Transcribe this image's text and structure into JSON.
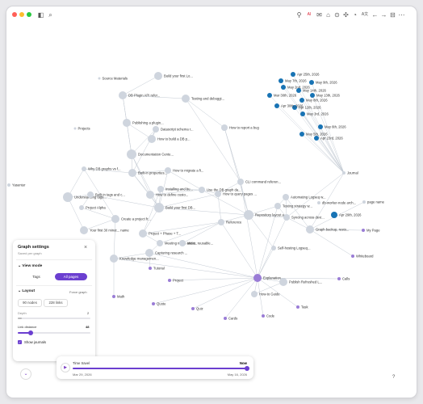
{
  "window": {
    "traffic_lights": [
      "#ff5f57",
      "#febc2e",
      "#28c840"
    ],
    "left_icons": [
      "sidebar-icon",
      "search-icon"
    ],
    "right_icons": [
      {
        "name": "person-icon",
        "glyph": "⚲"
      },
      {
        "name": "ai-badge-icon",
        "glyph": "AI"
      },
      {
        "name": "mail-icon",
        "glyph": "✉"
      },
      {
        "name": "home-icon",
        "glyph": "⌂"
      },
      {
        "name": "lock-icon",
        "glyph": "⊙"
      },
      {
        "name": "puzzle-icon",
        "glyph": "✣"
      },
      {
        "name": "alarm-icon",
        "glyph": "◔"
      },
      {
        "name": "translate-icon",
        "glyph": "A文"
      },
      {
        "name": "back-arrow-icon",
        "glyph": "←"
      },
      {
        "name": "forward-arrow-icon",
        "glyph": "→"
      },
      {
        "name": "split-icon",
        "glyph": "⊟"
      },
      {
        "name": "more-icon",
        "glyph": "⋯"
      }
    ]
  },
  "graph": {
    "nodes": [
      {
        "label": "Source Materials"
      },
      {
        "label": "Build your first Lo..."
      },
      {
        "label": "DB Plugin API refer..."
      },
      {
        "label": "Testing and debuggi..."
      },
      {
        "label": "Projects"
      },
      {
        "label": "Publishing a plugin..."
      },
      {
        "label": "Datascript schema r..."
      },
      {
        "label": "How to build a DB p..."
      },
      {
        "label": "How to report a bug"
      },
      {
        "label": "Documentation Cente..."
      },
      {
        "label": "Why DB graphs vs f..."
      },
      {
        "label": "Built-in properties..."
      },
      {
        "label": "How to migrate a fi..."
      },
      {
        "label": "Installing and bu..."
      },
      {
        "label": "Use the DB graph da..."
      },
      {
        "label": "CLI command referen..."
      },
      {
        "label": "Understanding tags..."
      },
      {
        "label": "Built-in tags and c..."
      },
      {
        "label": "How to define custo..."
      },
      {
        "label": "How to query pages ..."
      },
      {
        "label": "Automating Logseq w..."
      },
      {
        "label": "Build your first DB..."
      },
      {
        "label": "Project Alpha"
      },
      {
        "label": "Create a project fr..."
      },
      {
        "label": "Testing strategy w..."
      },
      {
        "label": "Repository layout a..."
      },
      {
        "label": "Syncing across devi..."
      },
      {
        "label": "Your first 30 minut... name"
      },
      {
        "label": "Project + Phase + T..."
      },
      {
        "label": "Meeting notes and t..."
      },
      {
        "label": "Ideas: reusable..."
      },
      {
        "label": "Capturing research ..."
      },
      {
        "label": "Knowledge managemen..."
      },
      {
        "label": "Reference"
      },
      {
        "label": "Graph backup, resto..."
      },
      {
        "label": "Self-hosting Logseq..."
      },
      {
        "label": "Explanation"
      },
      {
        "label": "How-to Guide"
      },
      {
        "label": "Publish Refreshed L..."
      },
      {
        "label": "Tutorial"
      },
      {
        "label": "Project"
      },
      {
        "label": "Math"
      },
      {
        "label": "Quote"
      },
      {
        "label": "Quiz"
      },
      {
        "label": "Cards"
      },
      {
        "label": "Code"
      },
      {
        "label": "Task"
      },
      {
        "label": "Calls"
      },
      {
        "label": "Whiteboard"
      },
      {
        "label": "My Page"
      },
      {
        "label": "page name"
      },
      {
        "label": "db-worker-node arch..."
      },
      {
        "label": "Journal"
      },
      {
        "label": "Apr 29th, 2026"
      },
      {
        "label": "Yasenter"
      }
    ],
    "journals": [
      "Apr 25th, 2026",
      "May 7th, 2026",
      "May 9th, 2026",
      "May 2nd, 2026",
      "May 14th, 2026",
      "Mar 30th, 2026",
      "May 8th, 2026",
      "May 13th, 2026",
      "Apr 12th, 2026",
      "Apr 30th, 2026",
      "May 3rd, 2026",
      "May 6th, 2026",
      "May 5th, 2026",
      "Apr 23rd, 2026"
    ]
  },
  "settings": {
    "title": "Graph settings",
    "subtitle": "Saved per graph",
    "view_mode": {
      "heading": "View mode",
      "options": [
        "Tags",
        "All pages"
      ],
      "selected": "All pages"
    },
    "layout": {
      "heading": "Layout",
      "preset": "Force graph",
      "nodes": "90 nodes",
      "links": "228 links",
      "depth_label": "Depth",
      "depth_value": "2",
      "depth_fraction": 0.05,
      "link_distance_label": "Link distance",
      "link_distance_value": "48",
      "link_distance_fraction": 0.18,
      "show_journals_label": "Show journals",
      "show_journals": true
    }
  },
  "timeline": {
    "label": "Time travel",
    "current": "Now",
    "start_date": "Mar 29, 2026",
    "end_date": "May 16, 2026",
    "position_fraction": 1.0
  },
  "colors": {
    "accent": "#6b3fd0",
    "journal_node": "#1873b4",
    "tag_node": "#9a7cd6",
    "page_node": "#cfd5de",
    "edge": "#c3cad3"
  },
  "misc": {
    "help": "?"
  }
}
